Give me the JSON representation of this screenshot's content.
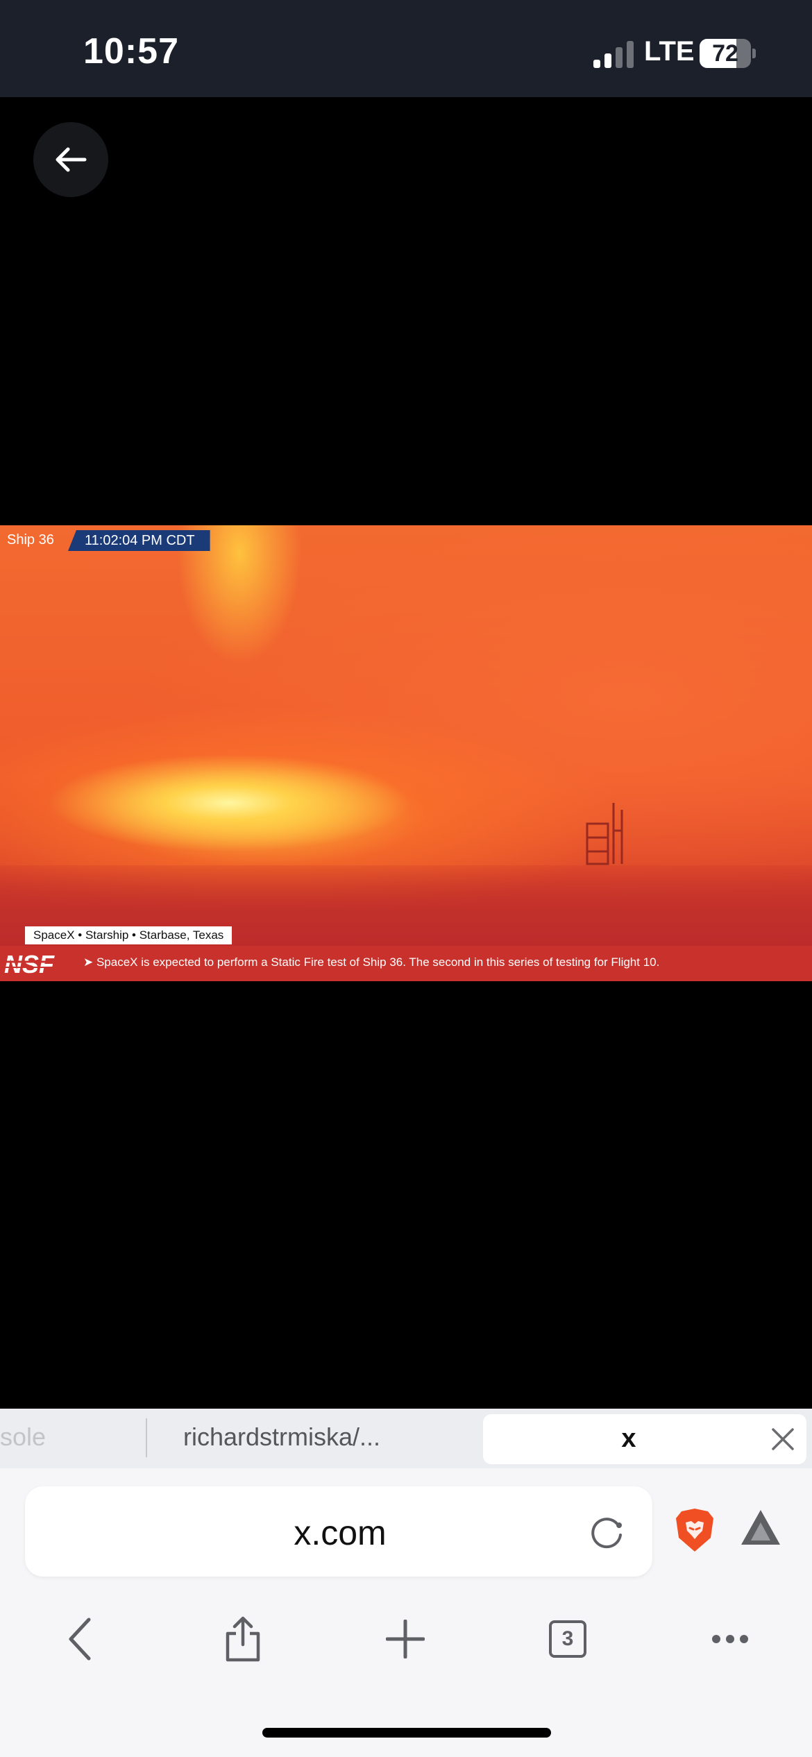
{
  "status_bar": {
    "time": "10:57",
    "network": "LTE",
    "battery_percent": "72",
    "battery_level": 0.72,
    "signal_bars_active": 2,
    "signal_bars_total": 4
  },
  "video": {
    "ship_label": "Ship 36",
    "timestamp": "11:02:04 PM CDT",
    "location_chip": "SpaceX  •  Starship  •  Starbase, Texas",
    "logo_text": "NSF",
    "ticker_text": "➤ SpaceX is expected to perform a Static Fire test of Ship 36. The second in this series of testing for Flight 10."
  },
  "tabs": [
    {
      "label": "sole"
    },
    {
      "label": "richardstrmiska/..."
    },
    {
      "label": "x",
      "active": true
    }
  ],
  "address_bar": {
    "url": "x.com"
  },
  "toolbar": {
    "tab_count": "3"
  },
  "colors": {
    "status_bg": "#1b202a",
    "ticker_red": "#c8312c",
    "timestamp_blue": "#1b3a78",
    "brave_orange": "#f04e23"
  },
  "icons": [
    "back-arrow-icon",
    "reload-icon",
    "brave-lion-icon",
    "rewards-triangle-icon",
    "chevron-left-icon",
    "share-icon",
    "plus-icon",
    "tab-count-icon",
    "more-icon",
    "close-icon"
  ]
}
